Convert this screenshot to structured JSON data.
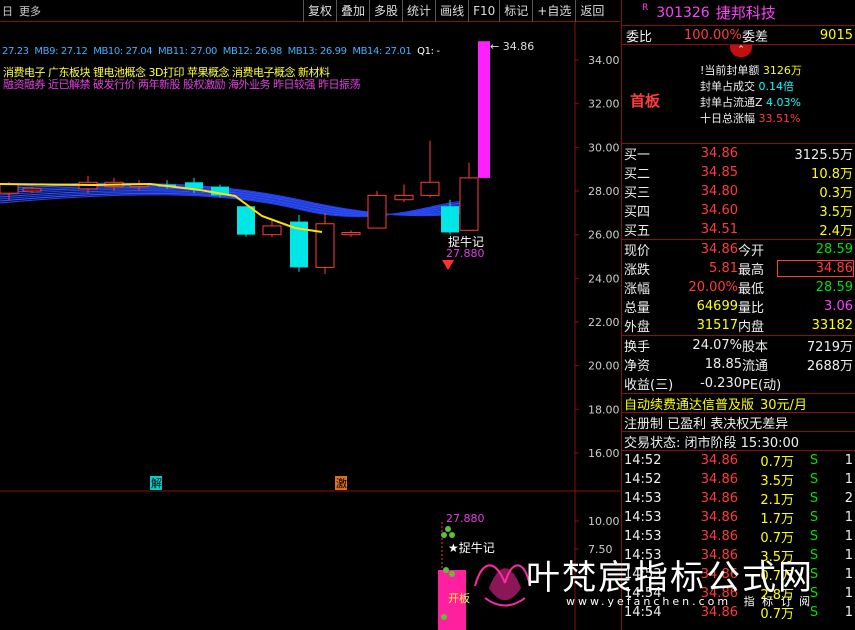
{
  "toolbar": {
    "left": [
      "日",
      "更多"
    ],
    "buttons": [
      "复权",
      "叠加",
      "多股",
      "统计",
      "画线",
      "F10",
      "标记",
      "+自选",
      "返回"
    ]
  },
  "ma_line": {
    "items": [
      "27.23",
      "MB9: 27.12",
      "MB10: 27.04",
      "MB11: 27.00",
      "MB12: 26.98",
      "MB13: 26.99",
      "MB14: 27.01",
      "Q1: -"
    ]
  },
  "concepts": {
    "line1": "消费电子  广东板块  锂电池概念 3D打印 苹果概念 消费电子概念 新材料",
    "line2": "融资融券 近已解禁 破发行价 两年新股 股权激励 海外业务 昨日较强 昨日振荡"
  },
  "chart_labels": {
    "high_marker": "34.86",
    "low_marker": "27.880",
    "catch_bull": "捉牛记",
    "jie": "解",
    "ji": "激",
    "sub_value": "27.880",
    "sub_catch": "★捉牛记",
    "sub_kaiban": "开板"
  },
  "chart_data": {
    "type": "candlestick",
    "y_axis_main": [
      "34.00",
      "32.00",
      "30.00",
      "28.00",
      "26.00",
      "24.00",
      "22.00",
      "20.00",
      "18.00",
      "16.00"
    ],
    "y_axis_sub": [
      "10.00",
      "7.50"
    ],
    "candles": [
      {
        "o": 27.9,
        "c": 28.3,
        "h": 28.4,
        "l": 27.6
      },
      {
        "o": 28.0,
        "c": 28.1,
        "h": 28.2,
        "l": 27.9
      },
      {
        "o": 28.1,
        "c": 28.4,
        "h": 28.7,
        "l": 27.9
      },
      {
        "o": 28.2,
        "c": 28.4,
        "h": 28.6,
        "l": 28.0
      },
      {
        "o": 28.2,
        "c": 28.3,
        "h": 28.5,
        "l": 28.0
      },
      {
        "o": 28.3,
        "c": 28.2,
        "h": 28.5,
        "l": 28.1
      },
      {
        "o": 28.4,
        "c": 28.1,
        "h": 28.6,
        "l": 27.9
      },
      {
        "o": 28.2,
        "c": 27.8,
        "h": 28.3,
        "l": 27.7
      },
      {
        "o": 27.3,
        "c": 26.0,
        "h": 27.3,
        "l": 25.9
      },
      {
        "o": 26.0,
        "c": 26.4,
        "h": 26.7,
        "l": 25.9
      },
      {
        "o": 26.6,
        "c": 24.5,
        "h": 26.9,
        "l": 24.3
      },
      {
        "o": 24.5,
        "c": 26.5,
        "h": 27.0,
        "l": 24.2
      },
      {
        "o": 26.0,
        "c": 26.1,
        "h": 26.2,
        "l": 25.9
      },
      {
        "o": 26.3,
        "c": 27.8,
        "h": 28.0,
        "l": 26.3
      },
      {
        "o": 27.6,
        "c": 27.8,
        "h": 28.3,
        "l": 27.5
      },
      {
        "o": 27.8,
        "c": 28.4,
        "h": 30.3,
        "l": 27.7
      },
      {
        "o": 27.3,
        "c": 26.1,
        "h": 27.6,
        "l": 26.0
      },
      {
        "o": 26.2,
        "c": 28.6,
        "h": 29.3,
        "l": 26.2
      },
      {
        "o": 28.6,
        "c": 34.86,
        "h": 34.86,
        "l": 28.6
      }
    ]
  },
  "right": {
    "badge": "R",
    "code": "301326",
    "name": "捷邦科技",
    "weibi_label": "委比",
    "weibi_val": "100.00%",
    "weicha_label": "委差",
    "weicha_val": "9015",
    "seal": {
      "title": "首板",
      "rows": [
        {
          "label": "!当前封单额",
          "value": "3126万"
        },
        {
          "label": "封单占成交",
          "value": "0.14倍"
        },
        {
          "label": "封单占流通Z",
          "value": "4.03%"
        },
        {
          "label": "十日总涨幅",
          "value": "33.51%"
        }
      ]
    },
    "sell": [
      {
        "label": "卖五",
        "price": "",
        "vol": ""
      },
      {
        "label": "卖四",
        "price": "",
        "vol": ""
      },
      {
        "label": "卖三",
        "price": "",
        "vol": ""
      },
      {
        "label": "卖二",
        "price": "",
        "vol": ""
      },
      {
        "label": "卖一",
        "price": "",
        "vol": ""
      }
    ],
    "buy": [
      {
        "label": "买一",
        "price": "34.86",
        "vol": "3125.5万"
      },
      {
        "label": "买二",
        "price": "34.85",
        "vol": "10.8万"
      },
      {
        "label": "买三",
        "price": "34.80",
        "vol": "0.3万"
      },
      {
        "label": "买四",
        "price": "34.60",
        "vol": "3.5万"
      },
      {
        "label": "买五",
        "price": "34.51",
        "vol": "2.4万"
      }
    ],
    "stats": [
      {
        "l1": "现价",
        "v1": "34.86",
        "l2": "今开",
        "v2": "28.59"
      },
      {
        "l1": "涨跌",
        "v1": "5.81",
        "l2": "最高",
        "v2": "34.86"
      },
      {
        "l1": "涨幅",
        "v1": "20.00%",
        "l2": "最低",
        "v2": "28.59"
      },
      {
        "l1": "总量",
        "v1": "64699",
        "l2": "量比",
        "v2": "3.06"
      },
      {
        "l1": "外盘",
        "v1": "31517",
        "l2": "内盘",
        "v2": "33182"
      }
    ],
    "stats2": [
      {
        "l1": "换手",
        "v1": "24.07%",
        "l2": "股本",
        "v2": "7219万"
      },
      {
        "l1": "净资",
        "v1": "18.85",
        "l2": "流通",
        "v2": "2688万"
      },
      {
        "l1": "收益(三)",
        "v1": "-0.230",
        "l2": "PE(动)",
        "v2": ""
      }
    ],
    "promo": "自动续费通达信普及版",
    "promo_price": "30元/月",
    "reg": "注册制 已盈利 表决权无差异",
    "trade_state": "交易状态: 闭市阶段 15:30:00",
    "ticks": [
      {
        "t": "14:52",
        "p": "34.86",
        "v": "0.7万",
        "s": "S",
        "n": "1"
      },
      {
        "t": "14:52",
        "p": "34.86",
        "v": "3.5万",
        "s": "S",
        "n": "1"
      },
      {
        "t": "14:53",
        "p": "34.86",
        "v": "2.1万",
        "s": "S",
        "n": "2"
      },
      {
        "t": "14:53",
        "p": "34.86",
        "v": "1.7万",
        "s": "S",
        "n": "1"
      },
      {
        "t": "14:53",
        "p": "34.86",
        "v": "0.7万",
        "s": "S",
        "n": "1"
      },
      {
        "t": "14:53",
        "p": "34.86",
        "v": "3.5万",
        "s": "S",
        "n": "1"
      },
      {
        "t": "14:53",
        "p": "34.86",
        "v": "0.7万",
        "s": "S",
        "n": "1"
      },
      {
        "t": "14:54",
        "p": "34.86",
        "v": "2.8万",
        "s": "S",
        "n": "1"
      },
      {
        "t": "14:54",
        "p": "34.86",
        "v": "0.7万",
        "s": "S",
        "n": "1"
      }
    ]
  },
  "watermark": {
    "text": "叶梵宸指标公式网",
    "url": "www.yefanchen.com",
    "sub": "指 标 订 阅"
  },
  "colors": {
    "up": "#ff3b3b",
    "down": "#00e5e5",
    "limit": "#ff20ff",
    "border": "#8a1010"
  }
}
